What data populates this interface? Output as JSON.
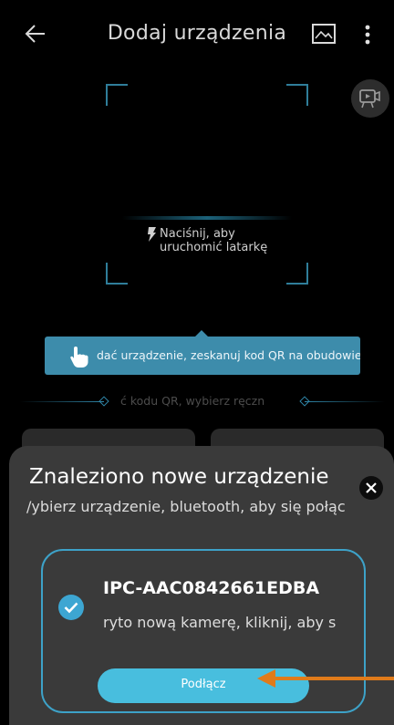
{
  "header": {
    "title": "Dodaj urządzenia",
    "back_icon": "arrow-left-icon",
    "gallery_icon": "image-icon",
    "more_icon": "more-vertical-icon"
  },
  "scanner": {
    "torch_hint": "Naciśnij, aby\nuruchomić latarkę",
    "side_button_icon": "video-camera-icon"
  },
  "hint": {
    "text": "dać urządzenie, zeskanuj kod QR na obudowie"
  },
  "divider": {
    "text": "ć kodu QR, wybierz ręczn"
  },
  "sheet": {
    "title": "Znaleziono nowe urządzenie",
    "subtitle": "/ybierz urządzenie, bluetooth, aby się połąc",
    "device": {
      "name": "IPC-AAC0842661EDBA",
      "description": "ryto nową kamerę, kliknij, aby s",
      "selected": true
    },
    "connect_label": "Podłącz"
  },
  "colors": {
    "accent": "#48bede",
    "frame": "#2f7e9a",
    "annotation": "#e07b1a",
    "sheet_bg": "#3a3a3a"
  }
}
